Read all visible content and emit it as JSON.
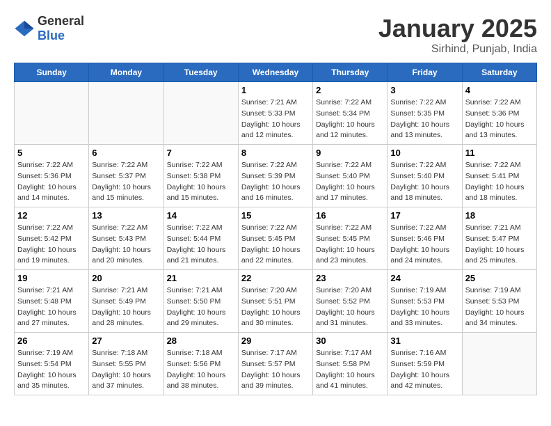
{
  "logo": {
    "general": "General",
    "blue": "Blue"
  },
  "title": "January 2025",
  "location": "Sirhind, Punjab, India",
  "days_of_week": [
    "Sunday",
    "Monday",
    "Tuesday",
    "Wednesday",
    "Thursday",
    "Friday",
    "Saturday"
  ],
  "weeks": [
    [
      {
        "day": "",
        "info": ""
      },
      {
        "day": "",
        "info": ""
      },
      {
        "day": "",
        "info": ""
      },
      {
        "day": "1",
        "info": "Sunrise: 7:21 AM\nSunset: 5:33 PM\nDaylight: 10 hours\nand 12 minutes."
      },
      {
        "day": "2",
        "info": "Sunrise: 7:22 AM\nSunset: 5:34 PM\nDaylight: 10 hours\nand 12 minutes."
      },
      {
        "day": "3",
        "info": "Sunrise: 7:22 AM\nSunset: 5:35 PM\nDaylight: 10 hours\nand 13 minutes."
      },
      {
        "day": "4",
        "info": "Sunrise: 7:22 AM\nSunset: 5:36 PM\nDaylight: 10 hours\nand 13 minutes."
      }
    ],
    [
      {
        "day": "5",
        "info": "Sunrise: 7:22 AM\nSunset: 5:36 PM\nDaylight: 10 hours\nand 14 minutes."
      },
      {
        "day": "6",
        "info": "Sunrise: 7:22 AM\nSunset: 5:37 PM\nDaylight: 10 hours\nand 15 minutes."
      },
      {
        "day": "7",
        "info": "Sunrise: 7:22 AM\nSunset: 5:38 PM\nDaylight: 10 hours\nand 15 minutes."
      },
      {
        "day": "8",
        "info": "Sunrise: 7:22 AM\nSunset: 5:39 PM\nDaylight: 10 hours\nand 16 minutes."
      },
      {
        "day": "9",
        "info": "Sunrise: 7:22 AM\nSunset: 5:40 PM\nDaylight: 10 hours\nand 17 minutes."
      },
      {
        "day": "10",
        "info": "Sunrise: 7:22 AM\nSunset: 5:40 PM\nDaylight: 10 hours\nand 18 minutes."
      },
      {
        "day": "11",
        "info": "Sunrise: 7:22 AM\nSunset: 5:41 PM\nDaylight: 10 hours\nand 18 minutes."
      }
    ],
    [
      {
        "day": "12",
        "info": "Sunrise: 7:22 AM\nSunset: 5:42 PM\nDaylight: 10 hours\nand 19 minutes."
      },
      {
        "day": "13",
        "info": "Sunrise: 7:22 AM\nSunset: 5:43 PM\nDaylight: 10 hours\nand 20 minutes."
      },
      {
        "day": "14",
        "info": "Sunrise: 7:22 AM\nSunset: 5:44 PM\nDaylight: 10 hours\nand 21 minutes."
      },
      {
        "day": "15",
        "info": "Sunrise: 7:22 AM\nSunset: 5:45 PM\nDaylight: 10 hours\nand 22 minutes."
      },
      {
        "day": "16",
        "info": "Sunrise: 7:22 AM\nSunset: 5:45 PM\nDaylight: 10 hours\nand 23 minutes."
      },
      {
        "day": "17",
        "info": "Sunrise: 7:22 AM\nSunset: 5:46 PM\nDaylight: 10 hours\nand 24 minutes."
      },
      {
        "day": "18",
        "info": "Sunrise: 7:21 AM\nSunset: 5:47 PM\nDaylight: 10 hours\nand 25 minutes."
      }
    ],
    [
      {
        "day": "19",
        "info": "Sunrise: 7:21 AM\nSunset: 5:48 PM\nDaylight: 10 hours\nand 27 minutes."
      },
      {
        "day": "20",
        "info": "Sunrise: 7:21 AM\nSunset: 5:49 PM\nDaylight: 10 hours\nand 28 minutes."
      },
      {
        "day": "21",
        "info": "Sunrise: 7:21 AM\nSunset: 5:50 PM\nDaylight: 10 hours\nand 29 minutes."
      },
      {
        "day": "22",
        "info": "Sunrise: 7:20 AM\nSunset: 5:51 PM\nDaylight: 10 hours\nand 30 minutes."
      },
      {
        "day": "23",
        "info": "Sunrise: 7:20 AM\nSunset: 5:52 PM\nDaylight: 10 hours\nand 31 minutes."
      },
      {
        "day": "24",
        "info": "Sunrise: 7:19 AM\nSunset: 5:53 PM\nDaylight: 10 hours\nand 33 minutes."
      },
      {
        "day": "25",
        "info": "Sunrise: 7:19 AM\nSunset: 5:53 PM\nDaylight: 10 hours\nand 34 minutes."
      }
    ],
    [
      {
        "day": "26",
        "info": "Sunrise: 7:19 AM\nSunset: 5:54 PM\nDaylight: 10 hours\nand 35 minutes."
      },
      {
        "day": "27",
        "info": "Sunrise: 7:18 AM\nSunset: 5:55 PM\nDaylight: 10 hours\nand 37 minutes."
      },
      {
        "day": "28",
        "info": "Sunrise: 7:18 AM\nSunset: 5:56 PM\nDaylight: 10 hours\nand 38 minutes."
      },
      {
        "day": "29",
        "info": "Sunrise: 7:17 AM\nSunset: 5:57 PM\nDaylight: 10 hours\nand 39 minutes."
      },
      {
        "day": "30",
        "info": "Sunrise: 7:17 AM\nSunset: 5:58 PM\nDaylight: 10 hours\nand 41 minutes."
      },
      {
        "day": "31",
        "info": "Sunrise: 7:16 AM\nSunset: 5:59 PM\nDaylight: 10 hours\nand 42 minutes."
      },
      {
        "day": "",
        "info": ""
      }
    ]
  ]
}
